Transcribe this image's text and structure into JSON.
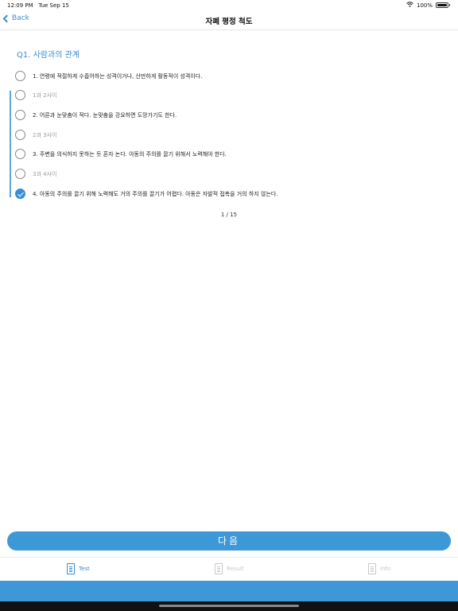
{
  "status": {
    "time": "12:09 PM",
    "date": "Tue Sep 15",
    "battery": "100%"
  },
  "nav": {
    "back_label": "Back",
    "title": "자폐 평정 척도"
  },
  "question": {
    "title": "Q1. 사람과의 관계",
    "options": [
      {
        "label": "1. 연령에 적절하게 수줍어하는 성격이거나, 산만하게 활동적이 성격이다.",
        "checked": false
      },
      {
        "label": "1과 2사이",
        "checked": false
      },
      {
        "label": "2. 어른과 눈맞춤이 적다. 눈맞춤을 강요하면 도망가기도 한다.",
        "checked": false
      },
      {
        "label": "2과 3사이",
        "checked": false
      },
      {
        "label": "3. 주변을 의식하지 못하는 듯 혼자 논다. 아동의 주의를 끌기 위해서 노력해야 한다.",
        "checked": false
      },
      {
        "label": "3과 4사이",
        "checked": false
      },
      {
        "label": "4. 아동의 주의를 끌기 위해 노력해도 거의 주의를 끌기가 어렵다. 아동은 자발적 접촉을 거의 하지 않는다.",
        "checked": true
      }
    ]
  },
  "pagination": {
    "label": "1 / 15"
  },
  "next_button": {
    "label": "다음"
  },
  "tabs": [
    {
      "label": "Test",
      "active": true
    },
    {
      "label": "Result",
      "active": false
    },
    {
      "label": "Info",
      "active": false
    }
  ],
  "colors": {
    "accent": "#3d98d8",
    "link": "#3a8dd6"
  }
}
